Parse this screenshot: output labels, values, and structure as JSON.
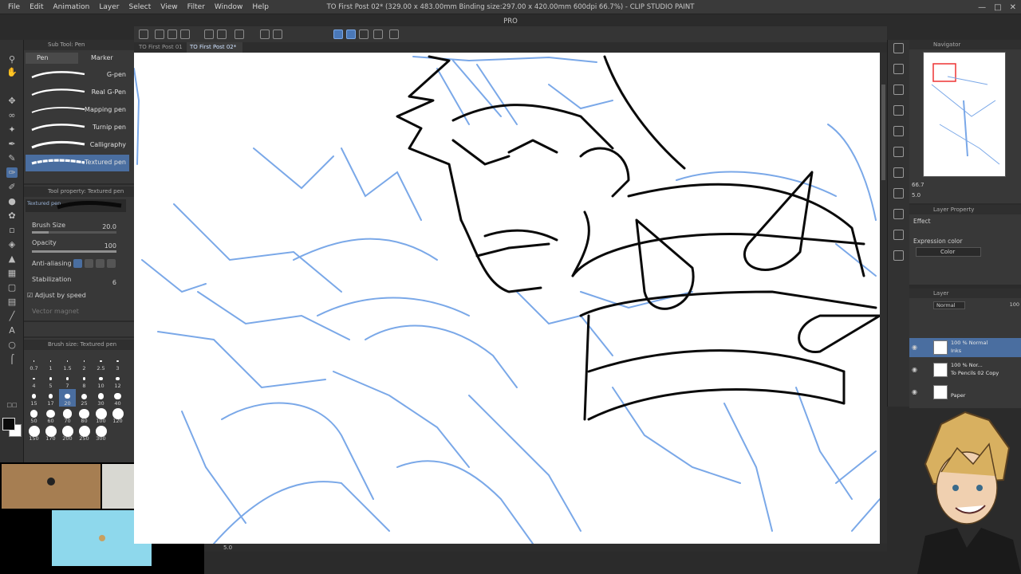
{
  "window": {
    "title": "TO First Post 02* (329.00 x 483.00mm Binding size:297.00 x 420.00mm 600dpi 66.7%) - CLIP STUDIO PAINT PRO"
  },
  "menu": [
    "File",
    "Edit",
    "Animation",
    "Layer",
    "Select",
    "View",
    "Filter",
    "Window",
    "Help"
  ],
  "tabs": [
    {
      "label": "TO First Post 01",
      "active": false
    },
    {
      "label": "TO First Post 02*",
      "active": true
    }
  ],
  "sub_tool": {
    "header": "Sub Tool: Pen",
    "tabs": [
      {
        "label": "Pen",
        "active": true
      },
      {
        "label": "Marker",
        "active": false
      }
    ],
    "brushes": [
      {
        "label": "G-pen",
        "active": false
      },
      {
        "label": "Real G-Pen",
        "active": false
      },
      {
        "label": "Mapping pen",
        "active": false
      },
      {
        "label": "Turnip pen",
        "active": false
      },
      {
        "label": "Calligraphy",
        "active": false
      },
      {
        "label": "Textured pen",
        "active": true
      }
    ]
  },
  "tool_property": {
    "header": "Tool property: Textured pen",
    "preview_label": "Textured pen",
    "brush_size_label": "Brush Size",
    "brush_size_value": "20.0",
    "brush_size_level": 0.2,
    "opacity_label": "Opacity",
    "opacity_value": "100",
    "opacity_level": 1.0,
    "antialiasing_label": "Anti-aliasing",
    "stabilization_label": "Stabilization",
    "stabilization_value": "6",
    "adjust_label": "Adjust by speed",
    "adjust_checked": true,
    "vector_magnet_label": "Vector magnet"
  },
  "brush_size_panel": {
    "header": "Brush size: Textured pen",
    "sizes": [
      "0.7",
      "1",
      "1.5",
      "2",
      "2.5",
      "3",
      "4",
      "5",
      "7",
      "8",
      "10",
      "12",
      "15",
      "17",
      "20",
      "25",
      "30",
      "40",
      "50",
      "60",
      "70",
      "80",
      "100",
      "120",
      "150",
      "170",
      "200",
      "250",
      "300"
    ],
    "selected": "20"
  },
  "canvas": {
    "zoom_status": "5.0"
  },
  "navigator": {
    "header": "Navigator",
    "zoom_value": "66.7",
    "angle_value": "5.0"
  },
  "layer_property": {
    "header": "Layer Property",
    "effect_label": "Effect",
    "expression_color_label": "Expression color",
    "expression_color_value": "Color"
  },
  "layer_panel": {
    "header": "Layer",
    "blend_mode": "Normal",
    "opacity": "100",
    "layers": [
      {
        "line1": "100 % Normal",
        "line2": "Inks",
        "active": true
      },
      {
        "line1": "100 % Nor...",
        "line2": "To Pencils 02 Copy",
        "active": false
      },
      {
        "line1": "",
        "line2": "Paper",
        "active": false
      }
    ]
  },
  "colors": {
    "accent": "#4a6ea0",
    "sketch_blue": "#7aa8e8",
    "ink": "#0a0a0a",
    "cam_tan": "#a67e52",
    "cam_gray": "#d8d8d2",
    "cam_cyan": "#8ed8ec"
  },
  "icons": [
    "zoom-icon",
    "hand-icon",
    "move-icon",
    "lasso-icon",
    "eyedropper-icon",
    "pen-icon",
    "pencil-icon",
    "brush-icon",
    "airbrush-icon",
    "eraser-icon",
    "fill-icon",
    "gradient-icon",
    "figure-icon",
    "frame-icon",
    "ruler-icon",
    "text-icon",
    "balloon-icon",
    "correct-line-icon"
  ]
}
